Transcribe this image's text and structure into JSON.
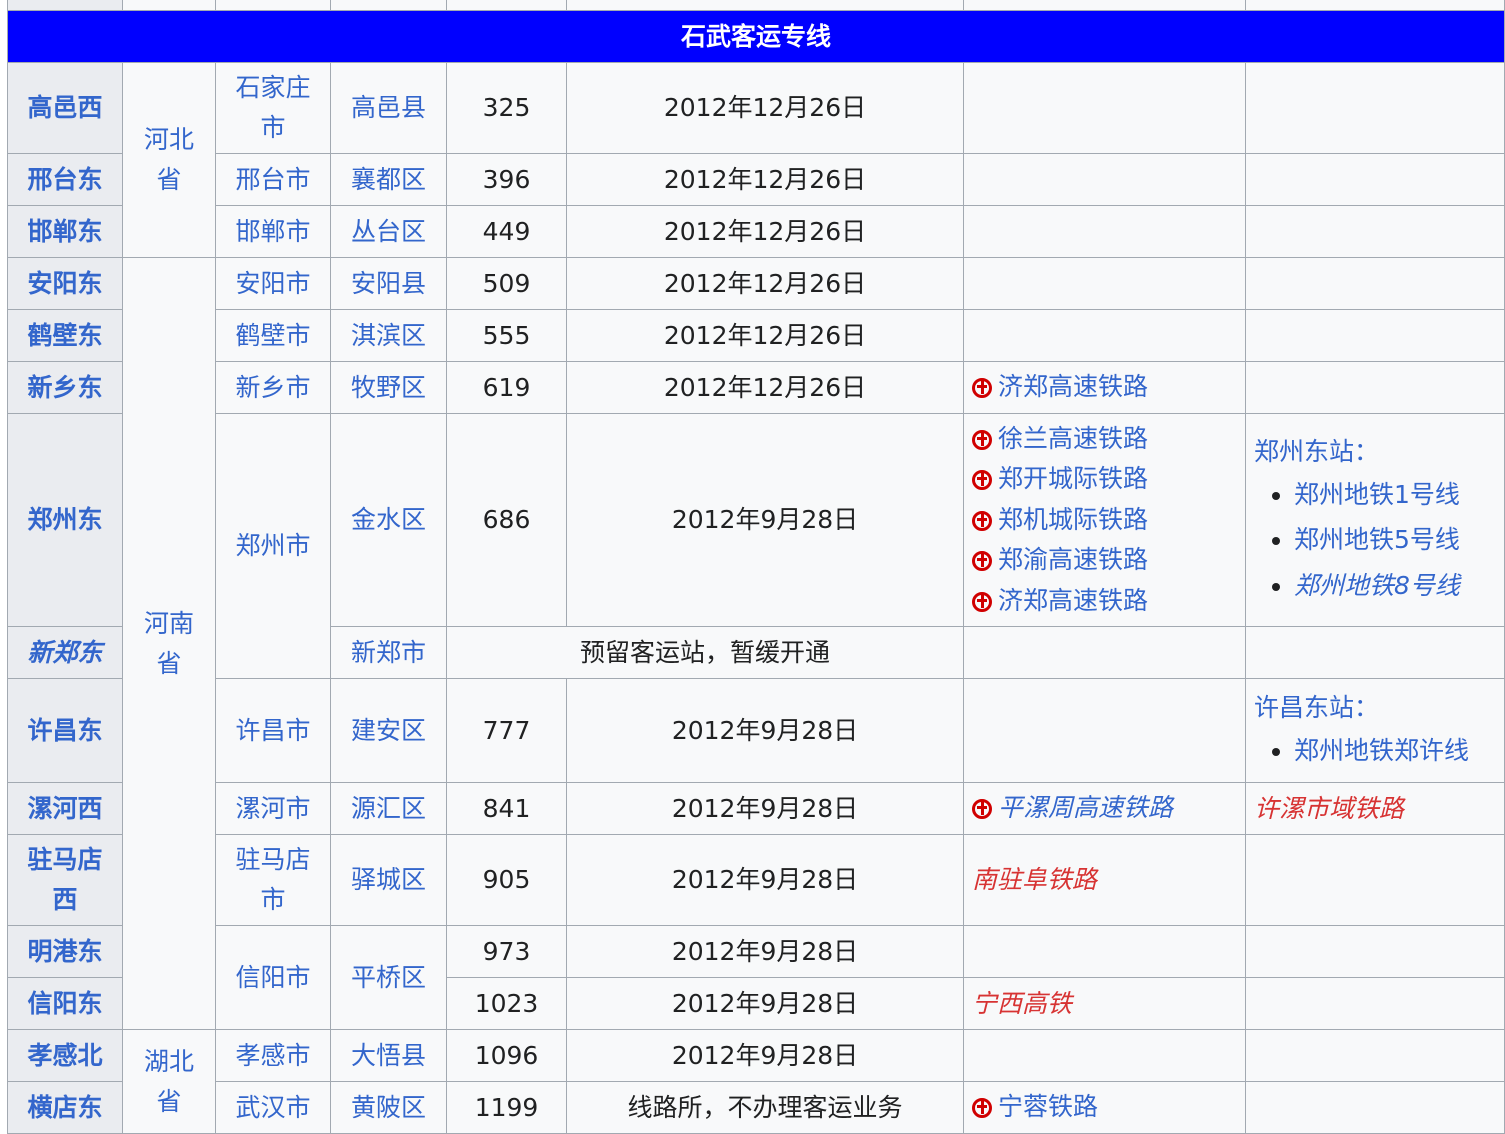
{
  "section_title": "石武客运专线",
  "rows": [
    {
      "station": "高邑西",
      "province": "河北省",
      "city": "石家庄市",
      "district": "高邑县",
      "km": "325",
      "date": "2012年12月26日",
      "transfer": [],
      "metro_head": "",
      "metro": []
    },
    {
      "station": "邢台东",
      "city": "邢台市",
      "district": "襄都区",
      "km": "396",
      "date": "2012年12月26日",
      "transfer": [],
      "metro_head": "",
      "metro": []
    },
    {
      "station": "邯郸东",
      "city": "邯郸市",
      "district": "丛台区",
      "km": "449",
      "date": "2012年12月26日",
      "transfer": [],
      "metro_head": "",
      "metro": []
    },
    {
      "station": "安阳东",
      "province": "河南省",
      "city": "安阳市",
      "district": "安阳县",
      "km": "509",
      "date": "2012年12月26日",
      "transfer": [],
      "metro_head": "",
      "metro": []
    },
    {
      "station": "鹤壁东",
      "city": "鹤壁市",
      "district": "淇滨区",
      "km": "555",
      "date": "2012年12月26日",
      "transfer": [],
      "metro_head": "",
      "metro": []
    },
    {
      "station": "新乡东",
      "city": "新乡市",
      "district": "牧野区",
      "km": "619",
      "date": "2012年12月26日",
      "transfer": [
        "济郑高速铁路"
      ],
      "metro_head": "",
      "metro": []
    },
    {
      "station": "郑州东",
      "city": "郑州市",
      "district": "金水区",
      "km": "686",
      "date": "2012年9月28日",
      "transfer": [
        "徐兰高速铁路",
        "郑开城际铁路",
        "郑机城际铁路",
        "郑渝高速铁路",
        "济郑高速铁路"
      ],
      "metro_head": "郑州东站：",
      "metro": [
        "郑州地铁1号线",
        "郑州地铁5号线",
        "郑州地铁8号线"
      ]
    },
    {
      "station": "新郑东",
      "district": "新郑市",
      "note": "预留客运站，暂缓开通"
    },
    {
      "station": "许昌东",
      "city": "许昌市",
      "district": "建安区",
      "km": "777",
      "date": "2012年9月28日",
      "transfer": [],
      "metro_head": "许昌东站：",
      "metro": [
        "郑州地铁郑许线"
      ]
    },
    {
      "station": "漯河西",
      "city": "漯河市",
      "district": "源汇区",
      "km": "841",
      "date": "2012年9月28日",
      "transfer": [
        "平漯周高速铁路"
      ],
      "metro_head": "许漯市域铁路",
      "metro": []
    },
    {
      "station": "驻马店西",
      "city": "驻马店市",
      "district": "驿城区",
      "km": "905",
      "date": "2012年9月28日",
      "transfer": [
        "南驻阜铁路"
      ],
      "metro_head": "",
      "metro": []
    },
    {
      "station": "明港东",
      "city": "信阳市",
      "district": "平桥区",
      "km": "973",
      "date": "2012年9月28日",
      "transfer": [],
      "metro_head": "",
      "metro": []
    },
    {
      "station": "信阳东",
      "km": "1023",
      "date": "2012年9月28日",
      "transfer": [
        "宁西高铁"
      ],
      "metro_head": "",
      "metro": []
    },
    {
      "station": "孝感北",
      "province": "湖北省",
      "city": "孝感市",
      "district": "大悟县",
      "km": "1096",
      "date": "2012年9月28日",
      "transfer": [],
      "metro_head": "",
      "metro": []
    },
    {
      "station": "横店东",
      "city": "武汉市",
      "district": "黄陂区",
      "km": "1199",
      "note": "线路所，不办理客运业务",
      "transfer": [
        "宁蓉铁路"
      ],
      "metro_head": "",
      "metro": []
    }
  ]
}
